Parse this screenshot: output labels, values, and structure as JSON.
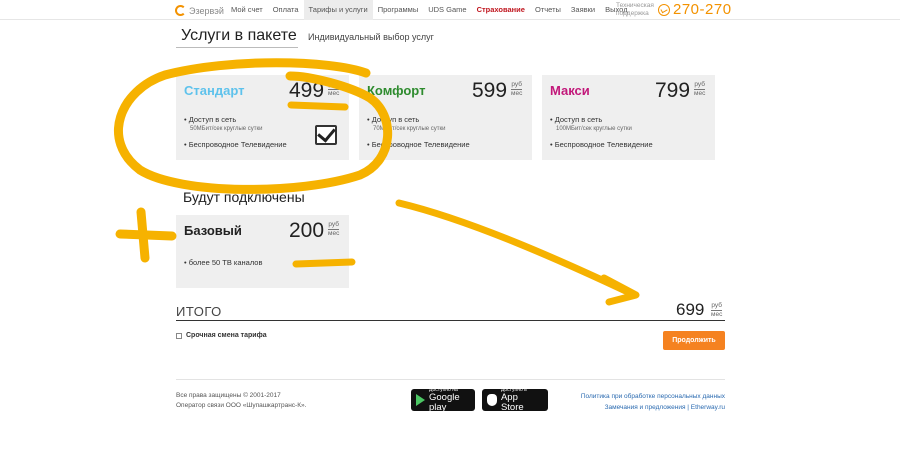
{
  "nav": {
    "logo": "Эзервэй",
    "items": [
      "Мой счет",
      "Оплата",
      "Тарифы и услуги",
      "Программы",
      "UDS Game",
      "Страхование",
      "Отчеты",
      "Заявки",
      "Выход"
    ],
    "support_line1": "Техническая",
    "support_line2": "поддержка",
    "phone": "270-270"
  },
  "section": {
    "title": "Услуги в пакете",
    "subtitle": "Индивидуальный выбор услуг",
    "connected": "Будут подключены"
  },
  "currency": {
    "top": "руб",
    "bottom": "мес"
  },
  "plans": [
    {
      "name": "Стандарт",
      "price": "499",
      "color": "#5ec2ec",
      "feature1": "Доступ в сеть",
      "feature1_sub": "50МБит/сек круглые сутки",
      "feature2": "Беспроводное Телевидение"
    },
    {
      "name": "Комфорт",
      "price": "599",
      "color": "#2e8b2e",
      "feature1": "Доступ в сеть",
      "feature1_sub": "70МБит/сек круглые сутки",
      "feature2": "Беспроводное Телевидение"
    },
    {
      "name": "Макси",
      "price": "799",
      "color": "#c2187a",
      "feature1": "Доступ в сеть",
      "feature1_sub": "100МБит/сек круглые сутки",
      "feature2": "Беспроводное Телевидение"
    }
  ],
  "addon": {
    "name": "Базовый",
    "price": "200",
    "feature": "более 50 ТВ каналов"
  },
  "total": {
    "label": "ИТОГО",
    "value": "699"
  },
  "urgent_label": "Срочная смена тарифа",
  "continue_label": "Продолжить",
  "footer": {
    "copyright": "Все права защищены © 2001-2017",
    "operator": "Оператор связи ООО «Шупашкартранс-К».",
    "google_small": "Доступно на",
    "google_big": "Google play",
    "apple_small": "Доступно в",
    "apple_big": "App Store",
    "link1": "Политика при обработке персональных данных",
    "link2": "Замечания и предложения | Etherway.ru"
  },
  "colors": {
    "accent": "#f58220",
    "marker": "#f6b200"
  }
}
